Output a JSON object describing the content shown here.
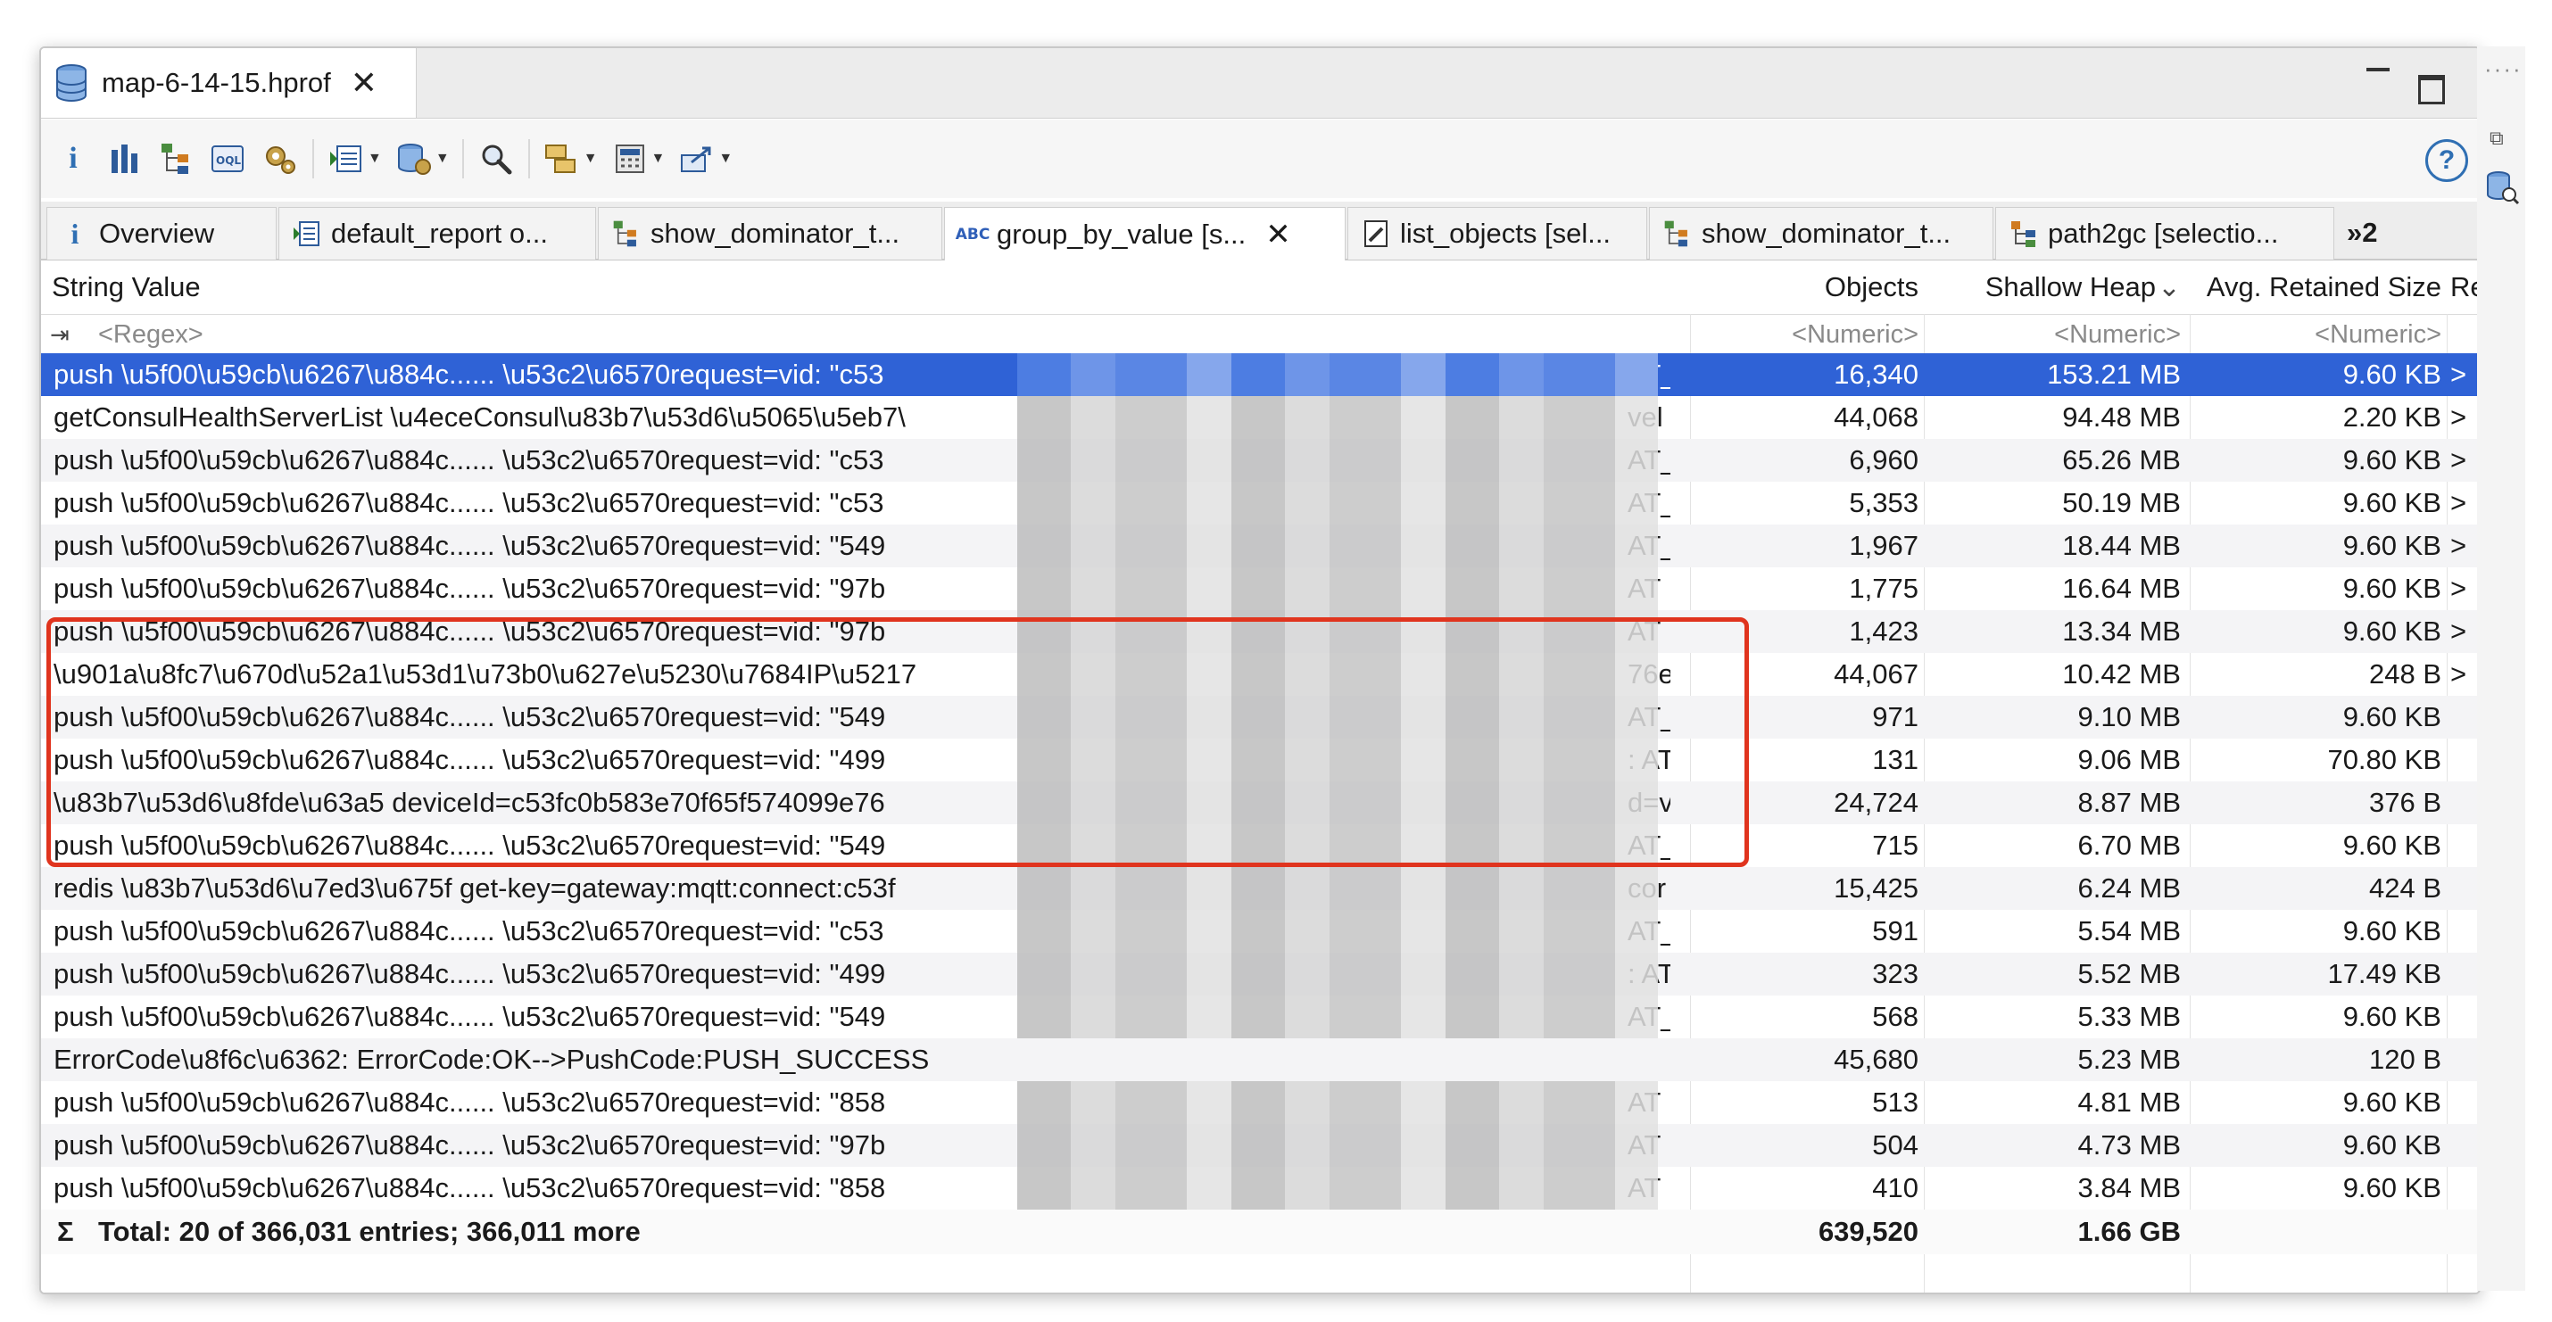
{
  "editor": {
    "title": "map-6-14-15.hprof"
  },
  "tabs": [
    {
      "label": "Overview",
      "icon": "info-icon"
    },
    {
      "label": "default_report o...",
      "icon": "report-icon"
    },
    {
      "label": "show_dominator_t...",
      "icon": "dominator-tree-icon"
    },
    {
      "label": "group_by_value [s...",
      "icon": "abc-icon",
      "active": true
    },
    {
      "label": "list_objects [sel...",
      "icon": "list-objects-icon"
    },
    {
      "label": "show_dominator_t...",
      "icon": "dominator-tree-icon"
    },
    {
      "label": "path2gc [selectio...",
      "icon": "path-icon"
    },
    {
      "label": "»2",
      "icon": ""
    }
  ],
  "columns": {
    "string_value": "String Value",
    "objects": "Objects",
    "shallow_heap": "Shallow Heap",
    "avg_retained": "Avg. Retained Size",
    "re": "Re"
  },
  "filter": {
    "regex": "<Regex>",
    "numeric": "<Numeric>"
  },
  "rows": [
    {
      "str": "push \\u5f00\\u59cb\\u6267\\u884c...... \\u53c2\\u6570request=vid: \"c53",
      "tail": "AT_",
      "objects": "16,340",
      "heap": "153.21 MB",
      "avg": "9.60 KB",
      "re": ">"
    },
    {
      "str": "getConsulHealthServerList \\u4eceConsul\\u83b7\\u53d6\\u5065\\u5eb7\\",
      "tail": "vel",
      "objects": "44,068",
      "heap": "94.48 MB",
      "avg": "2.20 KB",
      "re": ">"
    },
    {
      "str": "push \\u5f00\\u59cb\\u6267\\u884c...... \\u53c2\\u6570request=vid: \"c53",
      "tail": "AT_",
      "objects": "6,960",
      "heap": "65.26 MB",
      "avg": "9.60 KB",
      "re": ">"
    },
    {
      "str": "push \\u5f00\\u59cb\\u6267\\u884c...... \\u53c2\\u6570request=vid: \"c53",
      "tail": "AT_",
      "objects": "5,353",
      "heap": "50.19 MB",
      "avg": "9.60 KB",
      "re": ">"
    },
    {
      "str": "push \\u5f00\\u59cb\\u6267\\u884c...... \\u53c2\\u6570request=vid: \"549",
      "tail": "AT_",
      "objects": "1,967",
      "heap": "18.44 MB",
      "avg": "9.60 KB",
      "re": ">"
    },
    {
      "str": "push \\u5f00\\u59cb\\u6267\\u884c...... \\u53c2\\u6570request=vid: \"97b",
      "tail": "AT",
      "objects": "1,775",
      "heap": "16.64 MB",
      "avg": "9.60 KB",
      "re": ">"
    },
    {
      "str": "push \\u5f00\\u59cb\\u6267\\u884c...... \\u53c2\\u6570request=vid: \"97b",
      "tail": "AT",
      "objects": "1,423",
      "heap": "13.34 MB",
      "avg": "9.60 KB",
      "re": ">"
    },
    {
      "str": "\\u901a\\u8fc7\\u670d\\u52a1\\u53d1\\u73b0\\u627e\\u5230\\u7684IP\\u5217",
      "tail": "76e",
      "objects": "44,067",
      "heap": "10.42 MB",
      "avg": "248 B",
      "re": ">"
    },
    {
      "str": "push \\u5f00\\u59cb\\u6267\\u884c...... \\u53c2\\u6570request=vid: \"549",
      "tail": "AT_",
      "objects": "971",
      "heap": "9.10 MB",
      "avg": "9.60 KB",
      "re": ""
    },
    {
      "str": "push \\u5f00\\u59cb\\u6267\\u884c...... \\u53c2\\u6570request=vid: \"499",
      "tail": ": AT",
      "objects": "131",
      "heap": "9.06 MB",
      "avg": "70.80 KB",
      "re": ""
    },
    {
      "str": "\\u83b7\\u53d6\\u8fde\\u63a5 deviceId=c53fc0b583e70f65f574099e76",
      "tail": "d=v",
      "objects": "24,724",
      "heap": "8.87 MB",
      "avg": "376 B",
      "re": ""
    },
    {
      "str": "push \\u5f00\\u59cb\\u6267\\u884c...... \\u53c2\\u6570request=vid: \"549",
      "tail": "AT_",
      "objects": "715",
      "heap": "6.70 MB",
      "avg": "9.60 KB",
      "re": ""
    },
    {
      "str": "redis \\u83b7\\u53d6\\u7ed3\\u675f get-key=gateway:mqtt:connect:c53f",
      "tail": "cor",
      "objects": "15,425",
      "heap": "6.24 MB",
      "avg": "424 B",
      "re": ""
    },
    {
      "str": "push \\u5f00\\u59cb\\u6267\\u884c...... \\u53c2\\u6570request=vid: \"c53",
      "tail": "AT_",
      "objects": "591",
      "heap": "5.54 MB",
      "avg": "9.60 KB",
      "re": ""
    },
    {
      "str": "push \\u5f00\\u59cb\\u6267\\u884c...... \\u53c2\\u6570request=vid: \"499",
      "tail": ": AT",
      "objects": "323",
      "heap": "5.52 MB",
      "avg": "17.49 KB",
      "re": ""
    },
    {
      "str": "push \\u5f00\\u59cb\\u6267\\u884c...... \\u53c2\\u6570request=vid: \"549",
      "tail": "AT_",
      "objects": "568",
      "heap": "5.33 MB",
      "avg": "9.60 KB",
      "re": ""
    },
    {
      "str": "ErrorCode\\u8f6c\\u6362: ErrorCode:OK-->PushCode:PUSH_SUCCESS",
      "tail": "",
      "objects": "45,680",
      "heap": "5.23 MB",
      "avg": "120 B",
      "re": "",
      "noblur": true
    },
    {
      "str": "push \\u5f00\\u59cb\\u6267\\u884c...... \\u53c2\\u6570request=vid: \"858",
      "tail": "AT",
      "objects": "513",
      "heap": "4.81 MB",
      "avg": "9.60 KB",
      "re": ""
    },
    {
      "str": "push \\u5f00\\u59cb\\u6267\\u884c...... \\u53c2\\u6570request=vid: \"97b",
      "tail": "AT",
      "objects": "504",
      "heap": "4.73 MB",
      "avg": "9.60 KB",
      "re": ""
    },
    {
      "str": "push \\u5f00\\u59cb\\u6267\\u884c...... \\u53c2\\u6570request=vid: \"858",
      "tail": "AT",
      "objects": "410",
      "heap": "3.84 MB",
      "avg": "9.60 KB",
      "re": ""
    }
  ],
  "total": {
    "label": "Total: 20 of 366,031 entries; 366,011 more",
    "objects": "639,520",
    "heap": "1.66 GB"
  },
  "colors": {
    "selection": "#2f62d6",
    "highlight": "#e0341e"
  }
}
